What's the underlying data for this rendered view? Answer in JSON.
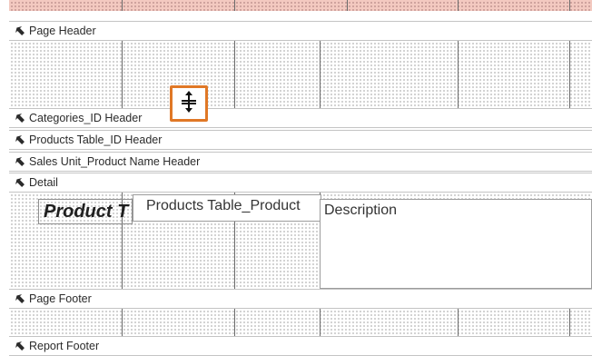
{
  "sections": {
    "page_header": "Page Header",
    "categories_id_header": "Categories_ID Header",
    "products_table_id_header": "Products Table_ID Header",
    "sales_unit_product_name_header": "Sales Unit_Product Name Header",
    "detail": "Detail",
    "page_footer": "Page Footer",
    "report_footer": "Report Footer"
  },
  "detail_controls": {
    "product_type": "Product T",
    "products_table_product": "Products Table_Product",
    "description": "Description"
  },
  "cursor": {
    "icon": "resize-vertical-cursor-icon",
    "highlight_color": "#e07826"
  },
  "colors": {
    "report_header_band": "#f3c9c0",
    "grid_dots": "#9a9a9a"
  }
}
